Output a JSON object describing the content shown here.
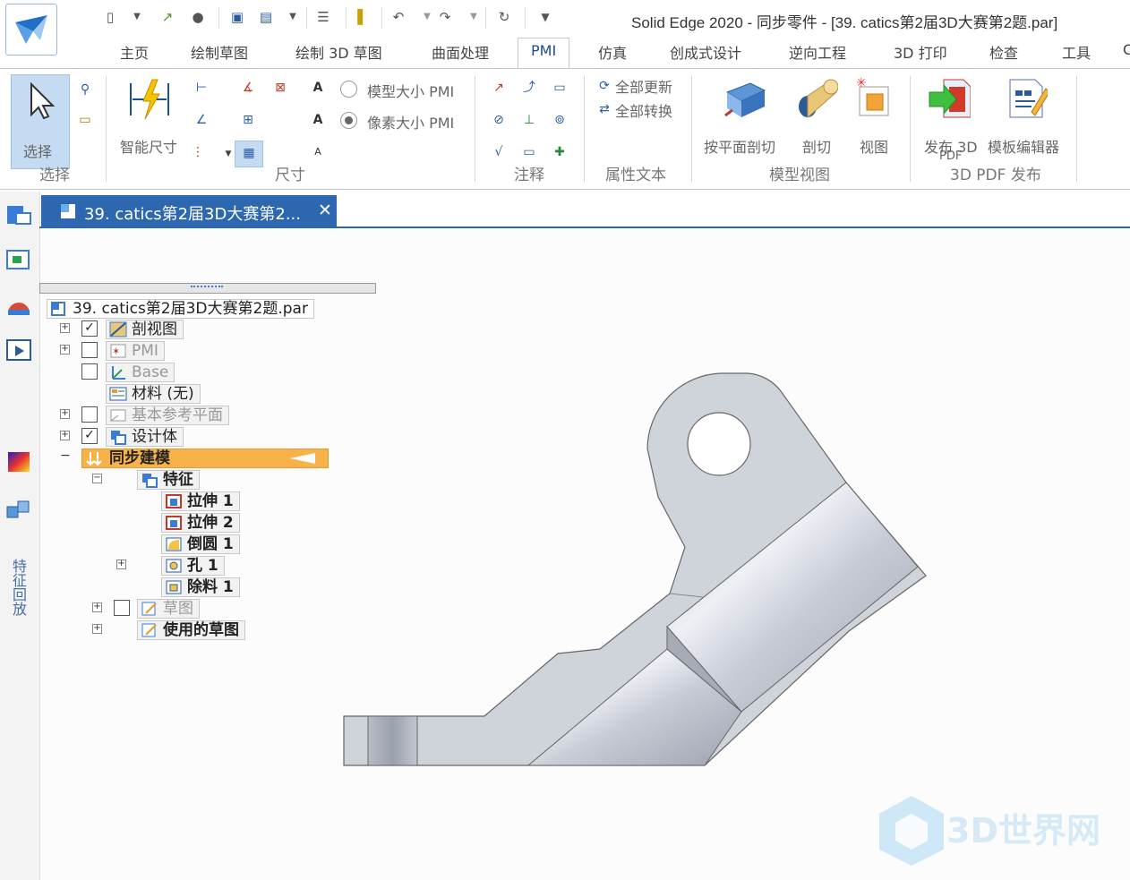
{
  "window": {
    "title": "Solid Edge 2020 - 同步零件 - [39. catics第2届3D大赛第2题.par]"
  },
  "tabs": [
    "主页",
    "绘制草图",
    "绘制 3D 草图",
    "曲面处理",
    "PMI",
    "仿真",
    "创成式设计",
    "逆向工程",
    "3D 打印",
    "检查",
    "工具",
    "C"
  ],
  "active_tab": "PMI",
  "ribbon": {
    "groups": {
      "select": "选择",
      "dimension": "尺寸",
      "annotation": "注释",
      "property_text": "属性文本",
      "model_view": "模型视图",
      "pdf_publish": "3D PDF 发布"
    },
    "buttons": {
      "select": "选择",
      "smart_dimension": "智能尺寸",
      "model_size_pmi": "模型大小 PMI",
      "pixel_size_pmi": "像素大小 PMI",
      "update_all": "全部更新",
      "convert_all": "全部转换",
      "section_by_plane": "按平面剖切",
      "section": "剖切",
      "view": "视图",
      "publish_3d_pdf_line1": "发布 3D",
      "publish_3d_pdf_line2": "PDF",
      "template_editor": "模板编辑器"
    },
    "radio_selected": "pixel_size_pmi"
  },
  "left_panel": {
    "vertical_label": "特征回放"
  },
  "document_tab": {
    "label": "39. catics第2届3D大赛第2...",
    "close": "✕"
  },
  "tree": {
    "root": "39. catics第2届3D大赛第2题.par",
    "items": [
      {
        "label": "剖视图",
        "checked": true,
        "expand": true
      },
      {
        "label": "PMI",
        "checked": false,
        "expand": true
      },
      {
        "label": "Base",
        "checked": false,
        "expand": false
      },
      {
        "label": "材料 (无)"
      },
      {
        "label": "基本参考平面",
        "checked": false,
        "expand": true
      },
      {
        "label": "设计体",
        "checked": true,
        "expand": true
      },
      {
        "label": "同步建模",
        "expand": true
      },
      {
        "label": "特征",
        "expand": true
      },
      {
        "label": "拉伸 1"
      },
      {
        "label": "拉伸 2"
      },
      {
        "label": "倒圆 1"
      },
      {
        "label": "孔 1",
        "expand": true
      },
      {
        "label": "除料 1"
      },
      {
        "label": "草图",
        "checked": false,
        "expand": true
      },
      {
        "label": "使用的草图",
        "expand": true
      }
    ]
  },
  "watermark": "3D世界网",
  "colors": {
    "accent": "#2d67b0",
    "active_node": "#f7b34a",
    "part": "#cfd3da"
  }
}
